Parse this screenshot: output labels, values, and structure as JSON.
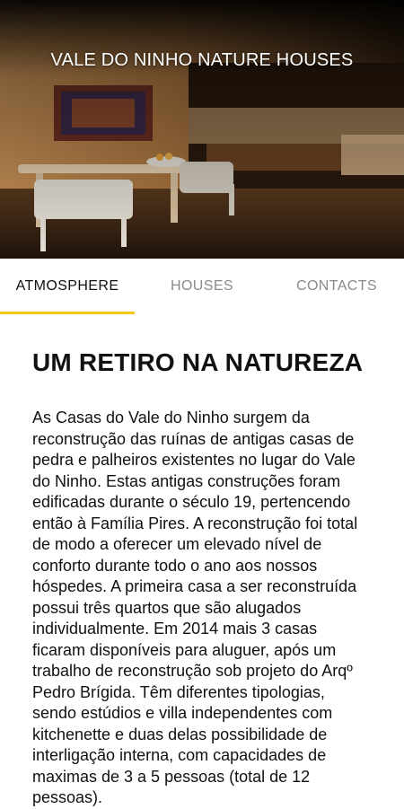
{
  "hero": {
    "title": "VALE DO NINHO NATURE HOUSES"
  },
  "tabs": [
    {
      "label": "ATMOSPHERE",
      "active": true
    },
    {
      "label": "HOUSES",
      "active": false
    },
    {
      "label": "CONTACTS",
      "active": false
    }
  ],
  "article": {
    "heading": "UM RETIRO NA NATUREZA",
    "body": "As Casas do Vale do Ninho surgem da reconstrução das ruínas de antigas casas de pedra e palheiros existentes no lugar do Vale do Ninho. Estas antigas construções foram edificadas durante o século 19, pertencendo então à Família Pires. A reconstrução foi total de modo a oferecer um elevado nível de conforto durante todo o ano aos nossos hóspedes. A primeira casa a ser reconstruída possui três quartos que são alugados individualmente. Em 2014 mais 3 casas ficaram disponíveis para aluguer, após um trabalho de reconstrução sob projeto do Arqº Pedro Brígida. Têm diferentes tipologias, sendo estúdios e villa independentes com kitchenette e duas delas possibilidade de interligação interna, com capacidades de maximas de 3 a 5 pessoas (total de 12 pessoas)."
  },
  "colors": {
    "accent": "#f5c518",
    "tab_inactive": "#8a8a8a"
  }
}
